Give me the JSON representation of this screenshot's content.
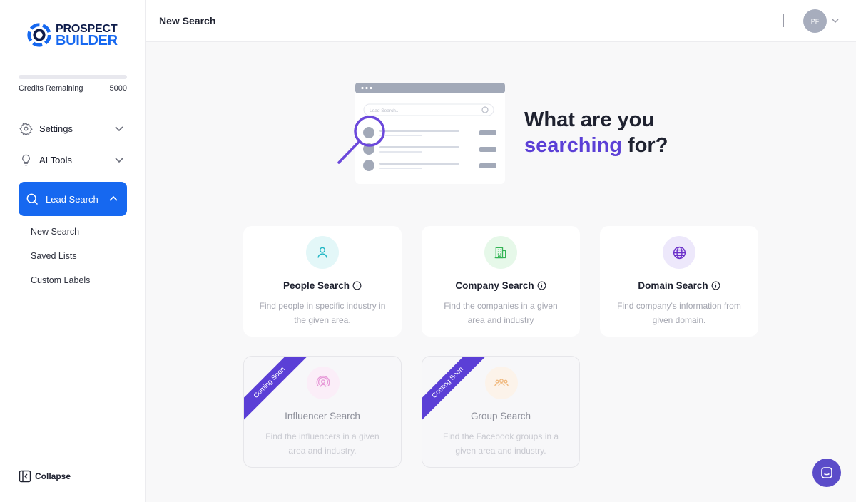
{
  "brand": {
    "line1": "PROSPECT",
    "line2": "BUILDER"
  },
  "credits": {
    "label": "Credits Remaining",
    "value": "5000",
    "used_fraction": 0
  },
  "sidebar": {
    "settings": "Settings",
    "ai_tools": "AI Tools",
    "lead_search": "Lead Search",
    "sub_items": [
      "New Search",
      "Saved Lists",
      "Custom Labels"
    ],
    "collapse": "Collapse"
  },
  "header": {
    "title": "New Search",
    "avatar_initials": "PF"
  },
  "hero": {
    "line1": "What are you",
    "accent": "searching",
    "rest": " for?",
    "illustration_search_placeholder": "Lead Search..."
  },
  "cards": {
    "people": {
      "title": "People Search",
      "desc": "Find people in specific industry in the given area.",
      "icon": "person-icon"
    },
    "company": {
      "title": "Company Search",
      "desc": "Find the companies in a given area and industry",
      "icon": "building-icon"
    },
    "domain": {
      "title": "Domain Search",
      "desc": "Find company's information from given domain.",
      "icon": "globe-icon"
    },
    "influencer": {
      "title": "Influencer Search",
      "desc": "Find the influencers in a given area and industry.",
      "ribbon": "Coming Soon",
      "icon": "broadcast-icon"
    },
    "group": {
      "title": "Group Search",
      "desc": "Find the Facebook groups in a given area and industry.",
      "ribbon": "Coming Soon",
      "icon": "group-icon"
    }
  },
  "colors": {
    "primary": "#1668f0",
    "accent": "#5b3fd6",
    "chat": "#5b4cc9"
  }
}
